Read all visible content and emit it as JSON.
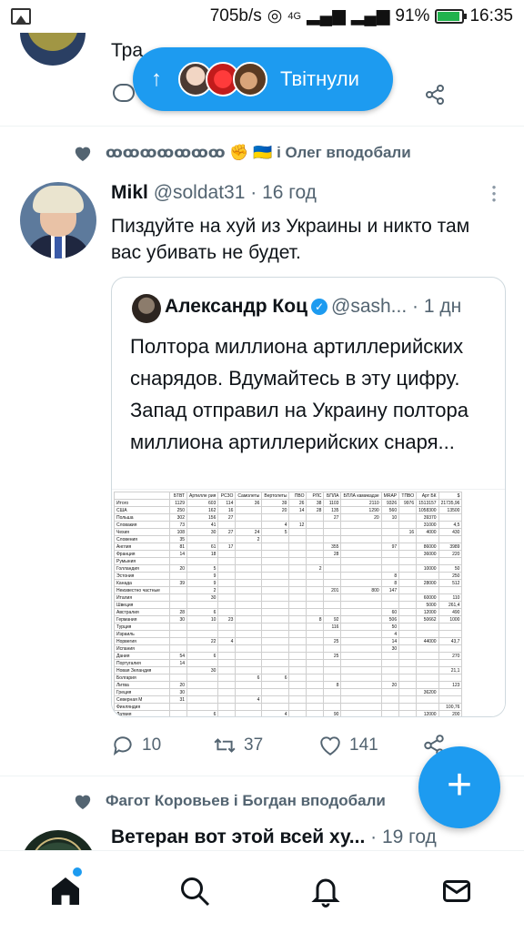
{
  "status_bar": {
    "speed": "705b/s",
    "network": "4G",
    "battery_text": "91%",
    "battery_level": 0.91,
    "time": "16:35"
  },
  "previous_tweet": {
    "text": "Тра"
  },
  "new_tweets_pill": {
    "arrow": "↑",
    "label": "Твітнули"
  },
  "tweet": {
    "social_context": "ꝏꝏꝏꝏꝏꝏꝏ ✊ 🇺🇦 і Олег вподобали",
    "author_name": "Mikl",
    "author_handle": "@soldat31",
    "time": "· 16 год",
    "text": "Пиздуйте на хуй из Украины и никто там вас убивать не будет.",
    "quote": {
      "author_name": "Александр Коц",
      "author_handle": "@sash...",
      "time": "· 1 дн",
      "text": "Полтора миллиона артиллерийских снарядов. Вдумайтесь в эту цифру. Запад отправил на Украину полтора миллиона артиллерийских снаря..."
    },
    "actions": {
      "replies": "10",
      "retweets": "37",
      "likes": "141"
    }
  },
  "media_table": {
    "headers": [
      "",
      "БТВТ",
      "Артилле рия",
      "РСЗО",
      "Самолеты",
      "Вертолеты",
      "ПВО",
      "РЛС",
      "БПЛА",
      "БПЛА камикадзе",
      "MRAP",
      "ТПВО",
      "Арт БК",
      "$"
    ],
    "rows": [
      [
        "Итого",
        "1129",
        "603",
        "114",
        "36",
        "39",
        "26",
        "38",
        "1103",
        "2110",
        "9326",
        "9976",
        "1513157",
        "21735,96"
      ],
      [
        "США",
        "250",
        "162",
        "16",
        "",
        "20",
        "14",
        "28",
        "135",
        "1290",
        "560",
        "",
        "1058300",
        "13500"
      ],
      [
        "Польша",
        "302",
        "156",
        "27",
        "",
        "",
        "",
        "",
        "27",
        "20",
        "10",
        "",
        "39370",
        ""
      ],
      [
        "Словакия",
        "73",
        "41",
        "",
        "",
        "4",
        "12",
        "",
        "",
        "",
        "",
        "",
        "31000",
        "4,5"
      ],
      [
        "Чехия",
        "108",
        "30",
        "27",
        "24",
        "5",
        "",
        "",
        "",
        "",
        "",
        "16",
        "4000",
        "430"
      ],
      [
        "Словения",
        "35",
        "",
        "",
        "2",
        "",
        "",
        "",
        "",
        "",
        "",
        "",
        "",
        ""
      ],
      [
        "Англия",
        "81",
        "61",
        "17",
        "",
        "",
        "",
        "",
        "355",
        "",
        "97",
        "",
        "86000",
        "3989"
      ],
      [
        "Франция",
        "14",
        "18",
        "",
        "",
        "",
        "",
        "",
        "28",
        "",
        "",
        "",
        "36000",
        "220"
      ],
      [
        "Румыния",
        "",
        "",
        "",
        "",
        "",
        "",
        "",
        "",
        "",
        "",
        "",
        "",
        ""
      ],
      [
        "Голландия",
        "20",
        "5",
        "",
        "",
        "",
        "",
        "2",
        "",
        "",
        "",
        "",
        "10000",
        "50"
      ],
      [
        "Эстония",
        "",
        "9",
        "",
        "",
        "",
        "",
        "",
        "",
        "",
        "8",
        "",
        "",
        "250"
      ],
      [
        "Канада",
        "39",
        "9",
        "",
        "",
        "",
        "",
        "",
        "",
        "",
        "8",
        "",
        "28000",
        "512"
      ],
      [
        "Неизвестно частные",
        "",
        "2",
        "",
        "",
        "",
        "",
        "",
        "201",
        "800",
        "147",
        "",
        "",
        ""
      ],
      [
        "Италия",
        "",
        "30",
        "",
        "",
        "",
        "",
        "",
        "",
        "",
        "",
        "",
        "60000",
        "110"
      ],
      [
        "Швеция",
        "",
        "",
        "",
        "",
        "",
        "",
        "",
        "",
        "",
        "",
        "",
        "5000",
        "261,4"
      ],
      [
        "Австралия",
        "28",
        "6",
        "",
        "",
        "",
        "",
        "",
        "",
        "",
        "60",
        "",
        "12000",
        "490"
      ],
      [
        "Германия",
        "30",
        "10",
        "23",
        "",
        "",
        "",
        "8",
        "92",
        "",
        "506",
        "",
        "50662",
        "1000"
      ],
      [
        "Турция",
        "",
        "",
        "",
        "",
        "",
        "",
        "",
        "116",
        "",
        "50",
        "",
        "",
        ""
      ],
      [
        "Израиль",
        "",
        "",
        "",
        "",
        "",
        "",
        "",
        "",
        "",
        "4",
        "",
        "",
        ""
      ],
      [
        "Норвегия",
        "",
        "22",
        "4",
        "",
        "",
        "",
        "",
        "25",
        "",
        "14",
        "",
        "44000",
        "43,7"
      ],
      [
        "Испания",
        "",
        "",
        "",
        "",
        "",
        "",
        "",
        "",
        "",
        "30",
        "",
        "",
        ""
      ],
      [
        "Дания",
        "54",
        "6",
        "",
        "",
        "",
        "",
        "",
        "25",
        "",
        "",
        "",
        "",
        "270"
      ],
      [
        "Португалия",
        "14",
        "",
        "",
        "",
        "",
        "",
        "",
        "",
        "",
        "",
        "",
        "",
        ""
      ],
      [
        "Новая Зеландия",
        "",
        "30",
        "",
        "",
        "",
        "",
        "",
        "",
        "",
        "",
        "",
        "",
        "21,1"
      ],
      [
        "Болгария",
        "",
        "",
        "",
        "6",
        "6",
        "",
        "",
        "",
        "",
        "",
        "",
        "",
        ""
      ],
      [
        "Литва",
        "20",
        "",
        "",
        "",
        "",
        "",
        "",
        "8",
        "",
        "20",
        "",
        "",
        "123"
      ],
      [
        "Греция",
        "30",
        "",
        "",
        "",
        "",
        "",
        "",
        "",
        "",
        "",
        "",
        "36200",
        ""
      ],
      [
        "Северная М",
        "31",
        "",
        "",
        "4",
        "",
        "",
        "",
        "",
        "",
        "",
        "",
        "",
        ""
      ],
      [
        "Финляндия",
        "",
        "",
        "",
        "",
        "",
        "",
        "",
        "",
        "",
        "",
        "",
        "",
        "100,76"
      ],
      [
        "Латвия",
        "",
        "6",
        "",
        "",
        "4",
        "",
        "",
        "90",
        "",
        "",
        "",
        "12000",
        "200"
      ],
      [
        "",
        "",
        "",
        "",
        "",
        "",
        "",
        "",
        "",
        "",
        "",
        "",
        "",
        "924,5"
      ]
    ]
  },
  "second_tweet": {
    "social_context": "Фагот Коровьев і Богдан вподобали",
    "author_name": "Ветеран вот этой всей ху...",
    "time": "· 19 год"
  },
  "fab": {
    "label": "+"
  }
}
